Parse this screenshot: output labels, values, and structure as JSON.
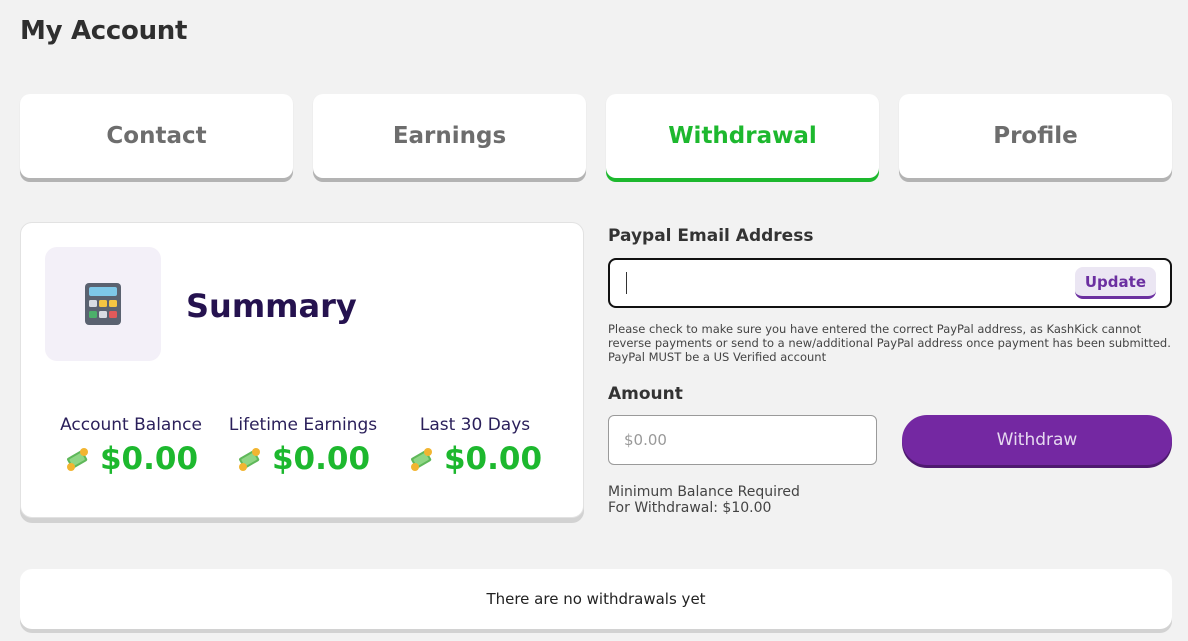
{
  "page": {
    "title": "My Account"
  },
  "tabs": [
    {
      "label": "Contact",
      "active": false
    },
    {
      "label": "Earnings",
      "active": false
    },
    {
      "label": "Withdrawal",
      "active": true
    },
    {
      "label": "Profile",
      "active": false
    }
  ],
  "summary": {
    "title": "Summary",
    "icon": "calculator-icon",
    "stats": [
      {
        "label": "Account Balance",
        "value": "$0.00",
        "icon": "money-icon"
      },
      {
        "label": "Lifetime Earnings",
        "value": "$0.00",
        "icon": "money-icon"
      },
      {
        "label": "Last 30 Days",
        "value": "$0.00",
        "icon": "money-icon"
      }
    ]
  },
  "withdraw_form": {
    "email_label": "Paypal Email Address",
    "email_value": "",
    "update_label": "Update",
    "note": "Please check to make sure you have entered the correct PayPal address, as KashKick cannot reverse payments or send to a new/additional PayPal address once payment has been submitted. PayPal MUST be a US Verified account",
    "amount_label": "Amount",
    "amount_placeholder": "$0.00",
    "withdraw_label": "Withdraw",
    "min_balance_line1": "Minimum Balance Required",
    "min_balance_line2": "For Withdrawal: $10.00"
  },
  "history": {
    "empty_text": "There are no withdrawals yet"
  },
  "colors": {
    "green": "#1db82e",
    "purple": "#7428a2",
    "navy": "#25124f"
  }
}
